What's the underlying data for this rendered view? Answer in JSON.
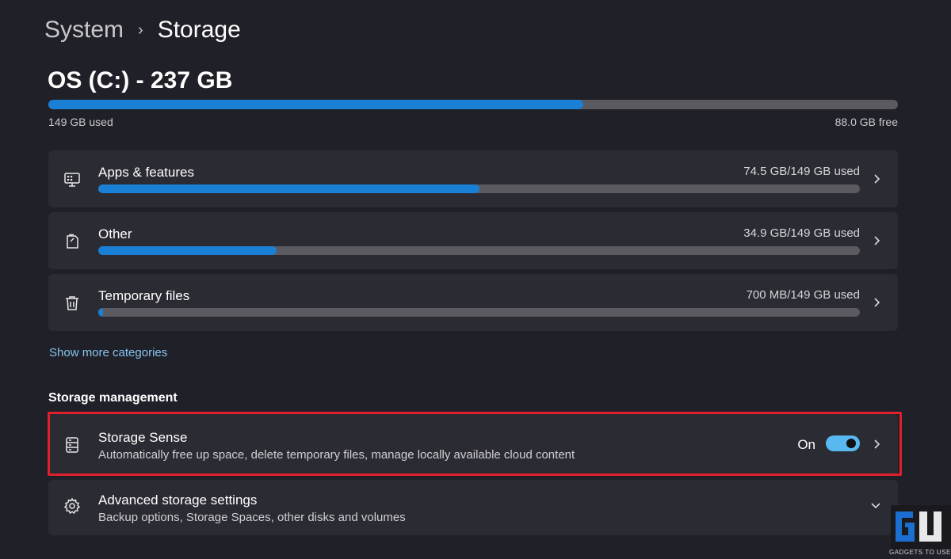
{
  "breadcrumb": {
    "parent": "System",
    "separator": "›",
    "current": "Storage"
  },
  "drive": {
    "title": "OS (C:) - 237 GB",
    "used_label": "149 GB used",
    "free_label": "88.0 GB free",
    "used_fraction": 0.63
  },
  "categories": [
    {
      "label": "Apps & features",
      "usage": "74.5 GB/149 GB used",
      "fraction": 0.5,
      "icon": "apps-icon"
    },
    {
      "label": "Other",
      "usage": "34.9 GB/149 GB used",
      "fraction": 0.234,
      "icon": "other-files-icon"
    },
    {
      "label": "Temporary files",
      "usage": "700 MB/149 GB used",
      "fraction": 0.005,
      "icon": "trash-icon"
    }
  ],
  "show_more": "Show more categories",
  "storage_management": {
    "title": "Storage management",
    "storage_sense": {
      "title": "Storage Sense",
      "description": "Automatically free up space, delete temporary files, manage locally available cloud content",
      "toggle_label": "On",
      "toggle_on": true
    },
    "advanced": {
      "title": "Advanced storage settings",
      "description": "Backup options, Storage Spaces, other disks and volumes"
    }
  },
  "watermark": {
    "caption": "GADGETS TO USE"
  },
  "colors": {
    "background": "#202028",
    "card": "#2b2b33",
    "accent": "#1a80d6",
    "link": "#86c4f0",
    "toggle": "#58b8f0",
    "highlight": "#e0202c"
  }
}
